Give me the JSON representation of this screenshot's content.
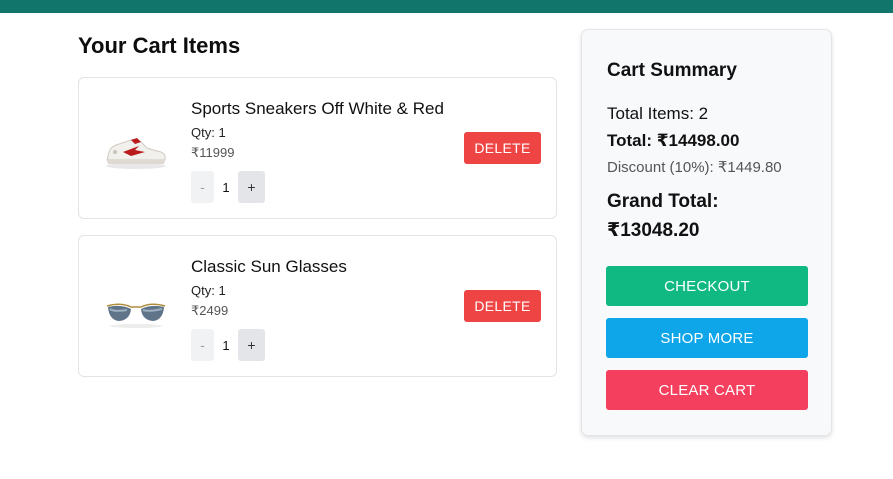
{
  "colors": {
    "topbar": "#12756b",
    "delete": "#ef4444",
    "checkout": "#10b981",
    "shop_more": "#0ea5e9",
    "clear_cart": "#f43f5e"
  },
  "cart": {
    "title": "Your Cart Items",
    "items": [
      {
        "name": "Sports Sneakers Off White & Red",
        "qty_label": "Qty: 1",
        "price": "₹11999",
        "qty": "1",
        "minus": "-",
        "plus": "+",
        "delete_label": "DELETE",
        "icon": "sneaker-image"
      },
      {
        "name": "Classic Sun Glasses",
        "qty_label": "Qty: 1",
        "price": "₹2499",
        "qty": "1",
        "minus": "-",
        "plus": "+",
        "delete_label": "DELETE",
        "icon": "sunglasses-image"
      }
    ]
  },
  "summary": {
    "title": "Cart Summary",
    "total_items": "Total Items: 2",
    "total": "Total: ₹14498.00",
    "discount": "Discount (10%): ₹1449.80",
    "grand_total_label": "Grand Total:",
    "grand_total_value": "₹13048.20",
    "checkout_label": "CHECKOUT",
    "shop_more_label": "SHOP MORE",
    "clear_cart_label": "CLEAR CART"
  }
}
